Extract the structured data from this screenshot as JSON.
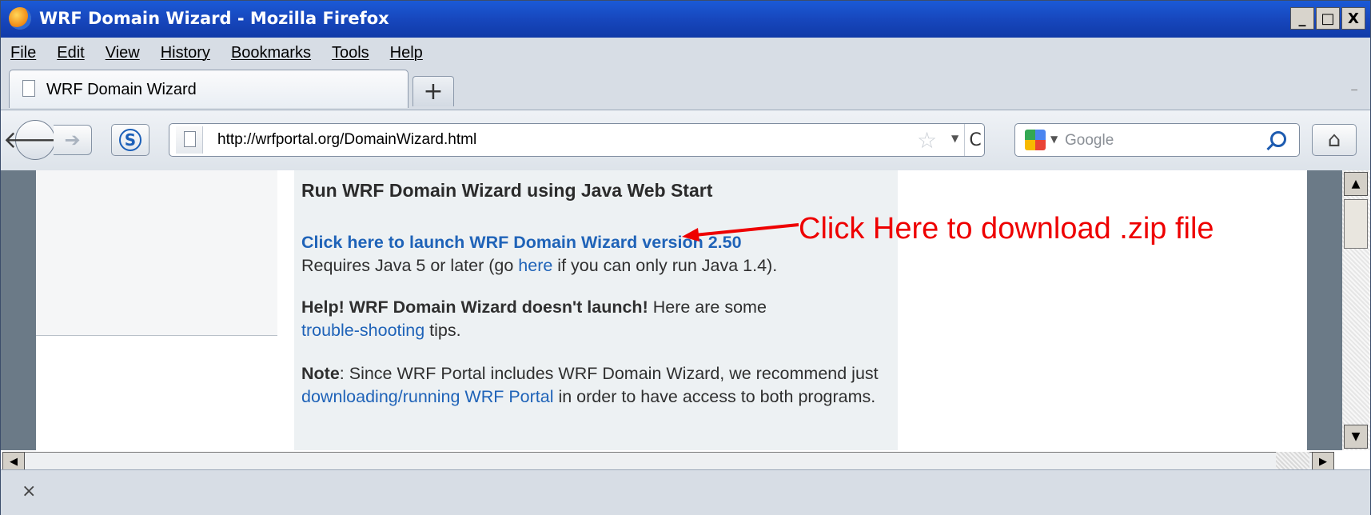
{
  "window": {
    "title": "WRF Domain Wizard - Mozilla Firefox",
    "minimize": "_",
    "maximize": "□",
    "close": "X"
  },
  "menu": [
    "File",
    "Edit",
    "View",
    "History",
    "Bookmarks",
    "Tools",
    "Help"
  ],
  "tab": {
    "label": "WRF Domain Wizard",
    "new_tab": "+"
  },
  "nav": {
    "back": "🡐",
    "forward": "➔",
    "s_label": "S",
    "url": "http://wrfportal.org/DomainWizard.html",
    "star": "☆",
    "dropdown": "▼",
    "reload": "C",
    "search_placeholder": "Google",
    "home": "⌂"
  },
  "page": {
    "heading": "Run WRF Domain Wizard using Java Web Start",
    "launch_link": "Click here to launch WRF Domain Wizard version 2.50",
    "requires_pre": "Requires Java 5 or later (go ",
    "requires_link": "here",
    "requires_post": " if you can only run Java 1.4).",
    "help_bold": "Help! WRF Domain Wizard doesn't launch!",
    "help_post": " Here are some",
    "help_link": "trouble-shooting",
    "help_tail": " tips.",
    "note_bold": "Note",
    "note_text": ": Since WRF Portal includes WRF Domain Wizard, we recommend just ",
    "note_link": "downloading/running WRF Portal",
    "note_tail": " in order to have access to both programs."
  },
  "annotation": {
    "text": "Click Here to download .zip file",
    "color": "#ee0000"
  },
  "status": {
    "close": "×"
  },
  "colors": {
    "accent": "#1f63b8",
    "titlebar": "#1747bd"
  }
}
